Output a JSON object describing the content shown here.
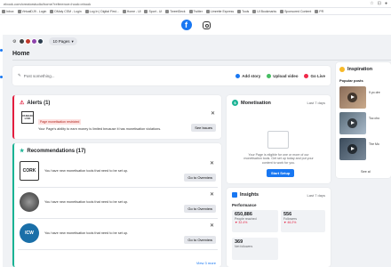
{
  "browser": {
    "url": "ebook.com/creatorstudio/home?reference=hook=ebook",
    "bookmarks": [
      "Inbox",
      "VirtualDJ9 - Login",
      "DMaly CSM - Login",
      "Log In | Digital First...",
      "Home - Ul",
      "Sport - Ul",
      "TweetDeck",
      "Twitter",
      "Limrette Express",
      "Tools",
      "Ul Bookmarks",
      "Sponsored Content",
      "PR"
    ]
  },
  "topnav": {
    "fb_letter": "f"
  },
  "pages": {
    "pill_label": "10 Pages"
  },
  "home_title": "Home",
  "post": {
    "placeholder": "Post something...",
    "add_story": "Add story",
    "upload_video": "Upload video",
    "go_live": "Go Live"
  },
  "alerts": {
    "title": "Alerts (1)",
    "logo_text": "DUBLIN LIVE",
    "badge": "Page monetisation restricted",
    "text": "Your Page's ability to earn money is limited because it has monetisation violations.",
    "button": "See Issues"
  },
  "recommendations": {
    "title": "Recommendations (17)",
    "items": [
      {
        "logo": "CORK",
        "text": "You have new monetisation tools that need to be set up.",
        "button": "Go to Overview"
      },
      {
        "logo": "",
        "text": "You have new monetisation tools that need to be set up.",
        "button": "Go to Overview"
      },
      {
        "logo": "ICW",
        "text": "You have new monetisation tools that need to be set up.",
        "button": "Go to Overview"
      }
    ],
    "see_more": "View 3 more"
  },
  "monetisation": {
    "title": "Monetisation",
    "period": "Last 7 days",
    "text": "Your Page is eligible for one or more of our monetisation tools. Get set up today and put your content to work for you.",
    "button": "Start Setup"
  },
  "insights": {
    "title": "Insights",
    "period": "Last 7 days",
    "performance": "Performance",
    "stats": [
      {
        "value": "650,886",
        "label": "People reached",
        "change": "▼ 32.4%"
      },
      {
        "value": "556",
        "label": "Followers",
        "change": "▼ 46.2%"
      },
      {
        "value": "369",
        "label": "Net followers",
        "change": ""
      }
    ]
  },
  "inspiration": {
    "title": "Inspiration",
    "popular": "Popular posts",
    "posts": [
      "9 yo dre",
      "Toc cho",
      "The Mo"
    ],
    "see_all": "See al"
  }
}
